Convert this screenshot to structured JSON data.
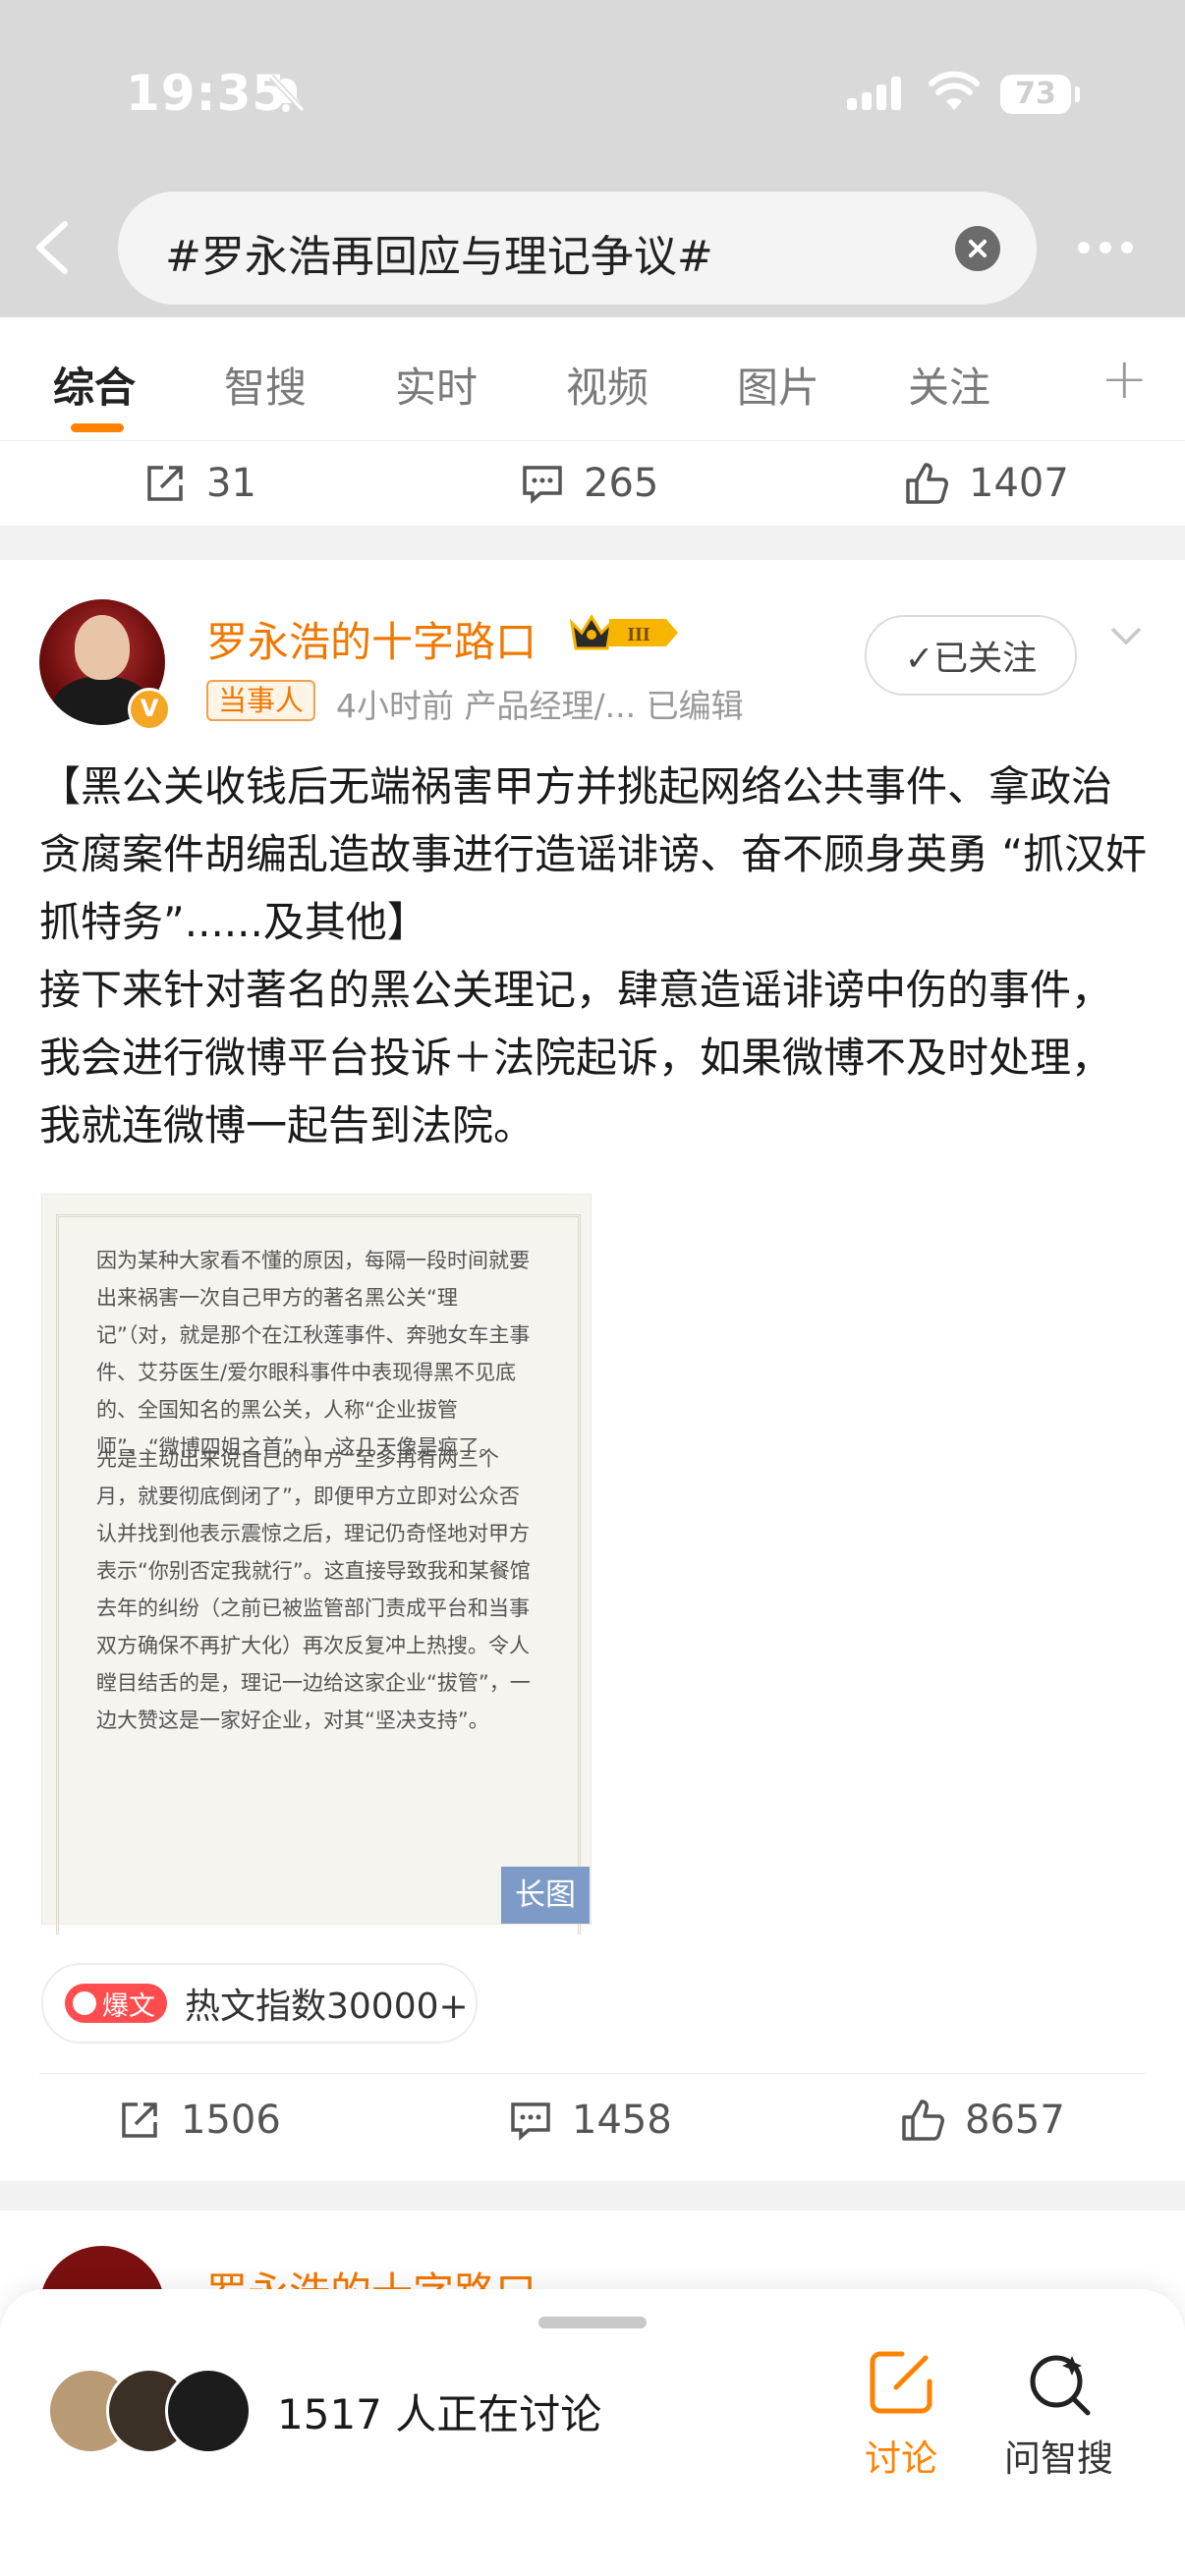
{
  "status_bar": {
    "time": "19:35",
    "battery": "73"
  },
  "header": {
    "query": "#罗永浩再回应与理记争议#"
  },
  "tabs": [
    "综合",
    "智搜",
    "实时",
    "视频",
    "图片",
    "关注"
  ],
  "prev_post_stats": {
    "reposts": "31",
    "comments": "265",
    "likes": "1407"
  },
  "post": {
    "author": "罗永浩的十字路口",
    "role_tag": "当事人",
    "meta": "4小时前  产品经理/...  已编辑",
    "follow_label": "✓已关注",
    "text": "【黑公关收钱后无端祸害甲方并挑起网络公共事件、拿政治贪腐案件胡编乱造故事进行造谣诽谤、奋不顾身英勇 “抓汉奸抓特务”......及其他】\n接下来针对著名的黑公关理记，肆意造谣诽谤中伤的事件，我会进行微博平台投诉＋法院起诉，如果微博不及时处理，我就连微博一起告到法院。",
    "image_paragraphs": [
      "因为某种大家看不懂的原因，每隔一段时间就要出来祸害一次自己甲方的著名黑公关“理记”（对，就是那个在江秋莲事件、奔驰女车主事件、艾芬医生/爱尔眼科事件中表现得黑不见底的、全国知名的黑公关，人称“企业拔管师”、“微博四姐之首”。），这几天像是疯了。",
      "先是主动出来说自己的甲方“至多再有两三个月，就要彻底倒闭了”，即便甲方立即对公众否认并找到他表示震惊之后，理记仍奇怪地对甲方表示“你别否定我就行”。这直接导致我和某餐馆去年的纠纷（之前已被监管部门责成平台和当事双方确保不再扩大化）再次反复冲上热搜。令人瞠目结舌的是，理记一边给这家企业“拔管”，一边大赞这是一家好企业，对其“坚决支持”。"
    ],
    "image_tag": "长图",
    "hot_badge": "爆文",
    "hot_text": "热文指数30000+",
    "stats": {
      "reposts": "1506",
      "comments": "1458",
      "likes": "8657"
    }
  },
  "next_post": {
    "author": "罗永浩的十字路口"
  },
  "bottom_sheet": {
    "discussing": "1517 人正在讨论",
    "discuss_label": "讨论",
    "ask_label": "问智搜"
  },
  "colors": {
    "accent": "#ff8200",
    "name": "#f07800"
  }
}
